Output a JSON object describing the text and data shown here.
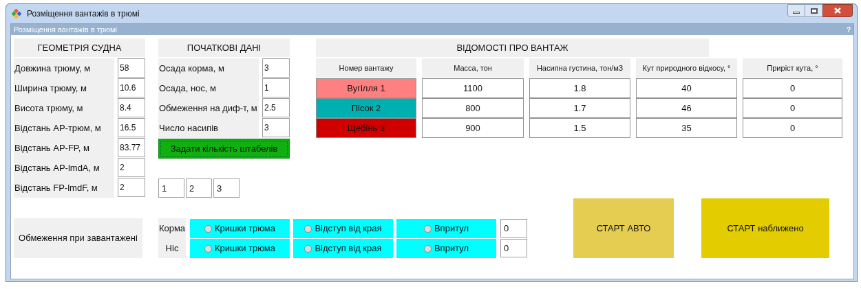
{
  "window": {
    "title": "Розміщення вантажів в трюмі"
  },
  "form": {
    "caption": "Розміщення вантажів в трюмі",
    "help": "?"
  },
  "geometry": {
    "title": "ГЕОМЕТРІЯ СУДНА",
    "fields": [
      {
        "label": "Довжина трюму, м",
        "value": "58"
      },
      {
        "label": "Ширина трюму, м",
        "value": "10.6"
      },
      {
        "label": "Висота трюму, м",
        "value": "8.4"
      },
      {
        "label": "Відстань АР-трюм, м",
        "value": "16.5"
      },
      {
        "label": "Відстань AP-FP, м",
        "value": "83.77"
      },
      {
        "label": "Відстань AP-lmdA, м",
        "value": "2"
      },
      {
        "label": "Відстань FP-lmdF, м",
        "value": "2"
      }
    ]
  },
  "initial_data": {
    "title": "ПОЧАТКОВІ ДАНІ",
    "fields": [
      {
        "label": "Осада корма, м",
        "value": "3"
      },
      {
        "label": "Осада, нос, м",
        "value": "1"
      },
      {
        "label": "Обмеження на диф-т, м",
        "value": "2.5"
      },
      {
        "label": "Число насипів",
        "value": "3"
      }
    ],
    "button": "Задати кількість штабелів",
    "stack_fields": [
      "1",
      "2",
      "3"
    ]
  },
  "cargo": {
    "title": "ВІДОМОСТІ ПРО ВАНТАЖ",
    "columns": [
      "Номер вантажу",
      "Масса, тон",
      "Насипна густина, тон/м3",
      "Кут природного відкосу, °",
      "Приріст кута, °"
    ],
    "rows": [
      {
        "name": "Вугілля 1",
        "color": "#ff8080",
        "values": [
          "1100",
          "1.8",
          "40",
          "0"
        ]
      },
      {
        "name": "Пісок 2",
        "color": "#00b0b0",
        "values": [
          "800",
          "1.7",
          "46",
          "0"
        ]
      },
      {
        "name": "Щебінь 3",
        "color": "#d00000",
        "values": [
          "900",
          "1.5",
          "35",
          "0"
        ]
      }
    ]
  },
  "loading_limits": {
    "title": "Обмеження при завантажені",
    "rows": [
      {
        "label": "Корма",
        "options": [
          {
            "label": "Кришки трюма",
            "selected": false
          },
          {
            "label": "Відступ від края",
            "selected": false
          },
          {
            "label": "Впритул",
            "selected": false
          }
        ],
        "value": "0"
      },
      {
        "label": "Ніс",
        "options": [
          {
            "label": "Кришки трюма",
            "selected": false
          },
          {
            "label": "Відступ від края",
            "selected": false
          },
          {
            "label": "Впритул",
            "selected": false
          }
        ],
        "value": "0"
      }
    ]
  },
  "buttons": [
    {
      "label": "СТАРТ АВТО",
      "color": "#e5cd52"
    },
    {
      "label": "СТАРТ наближено",
      "color": "#e3cc00"
    }
  ]
}
